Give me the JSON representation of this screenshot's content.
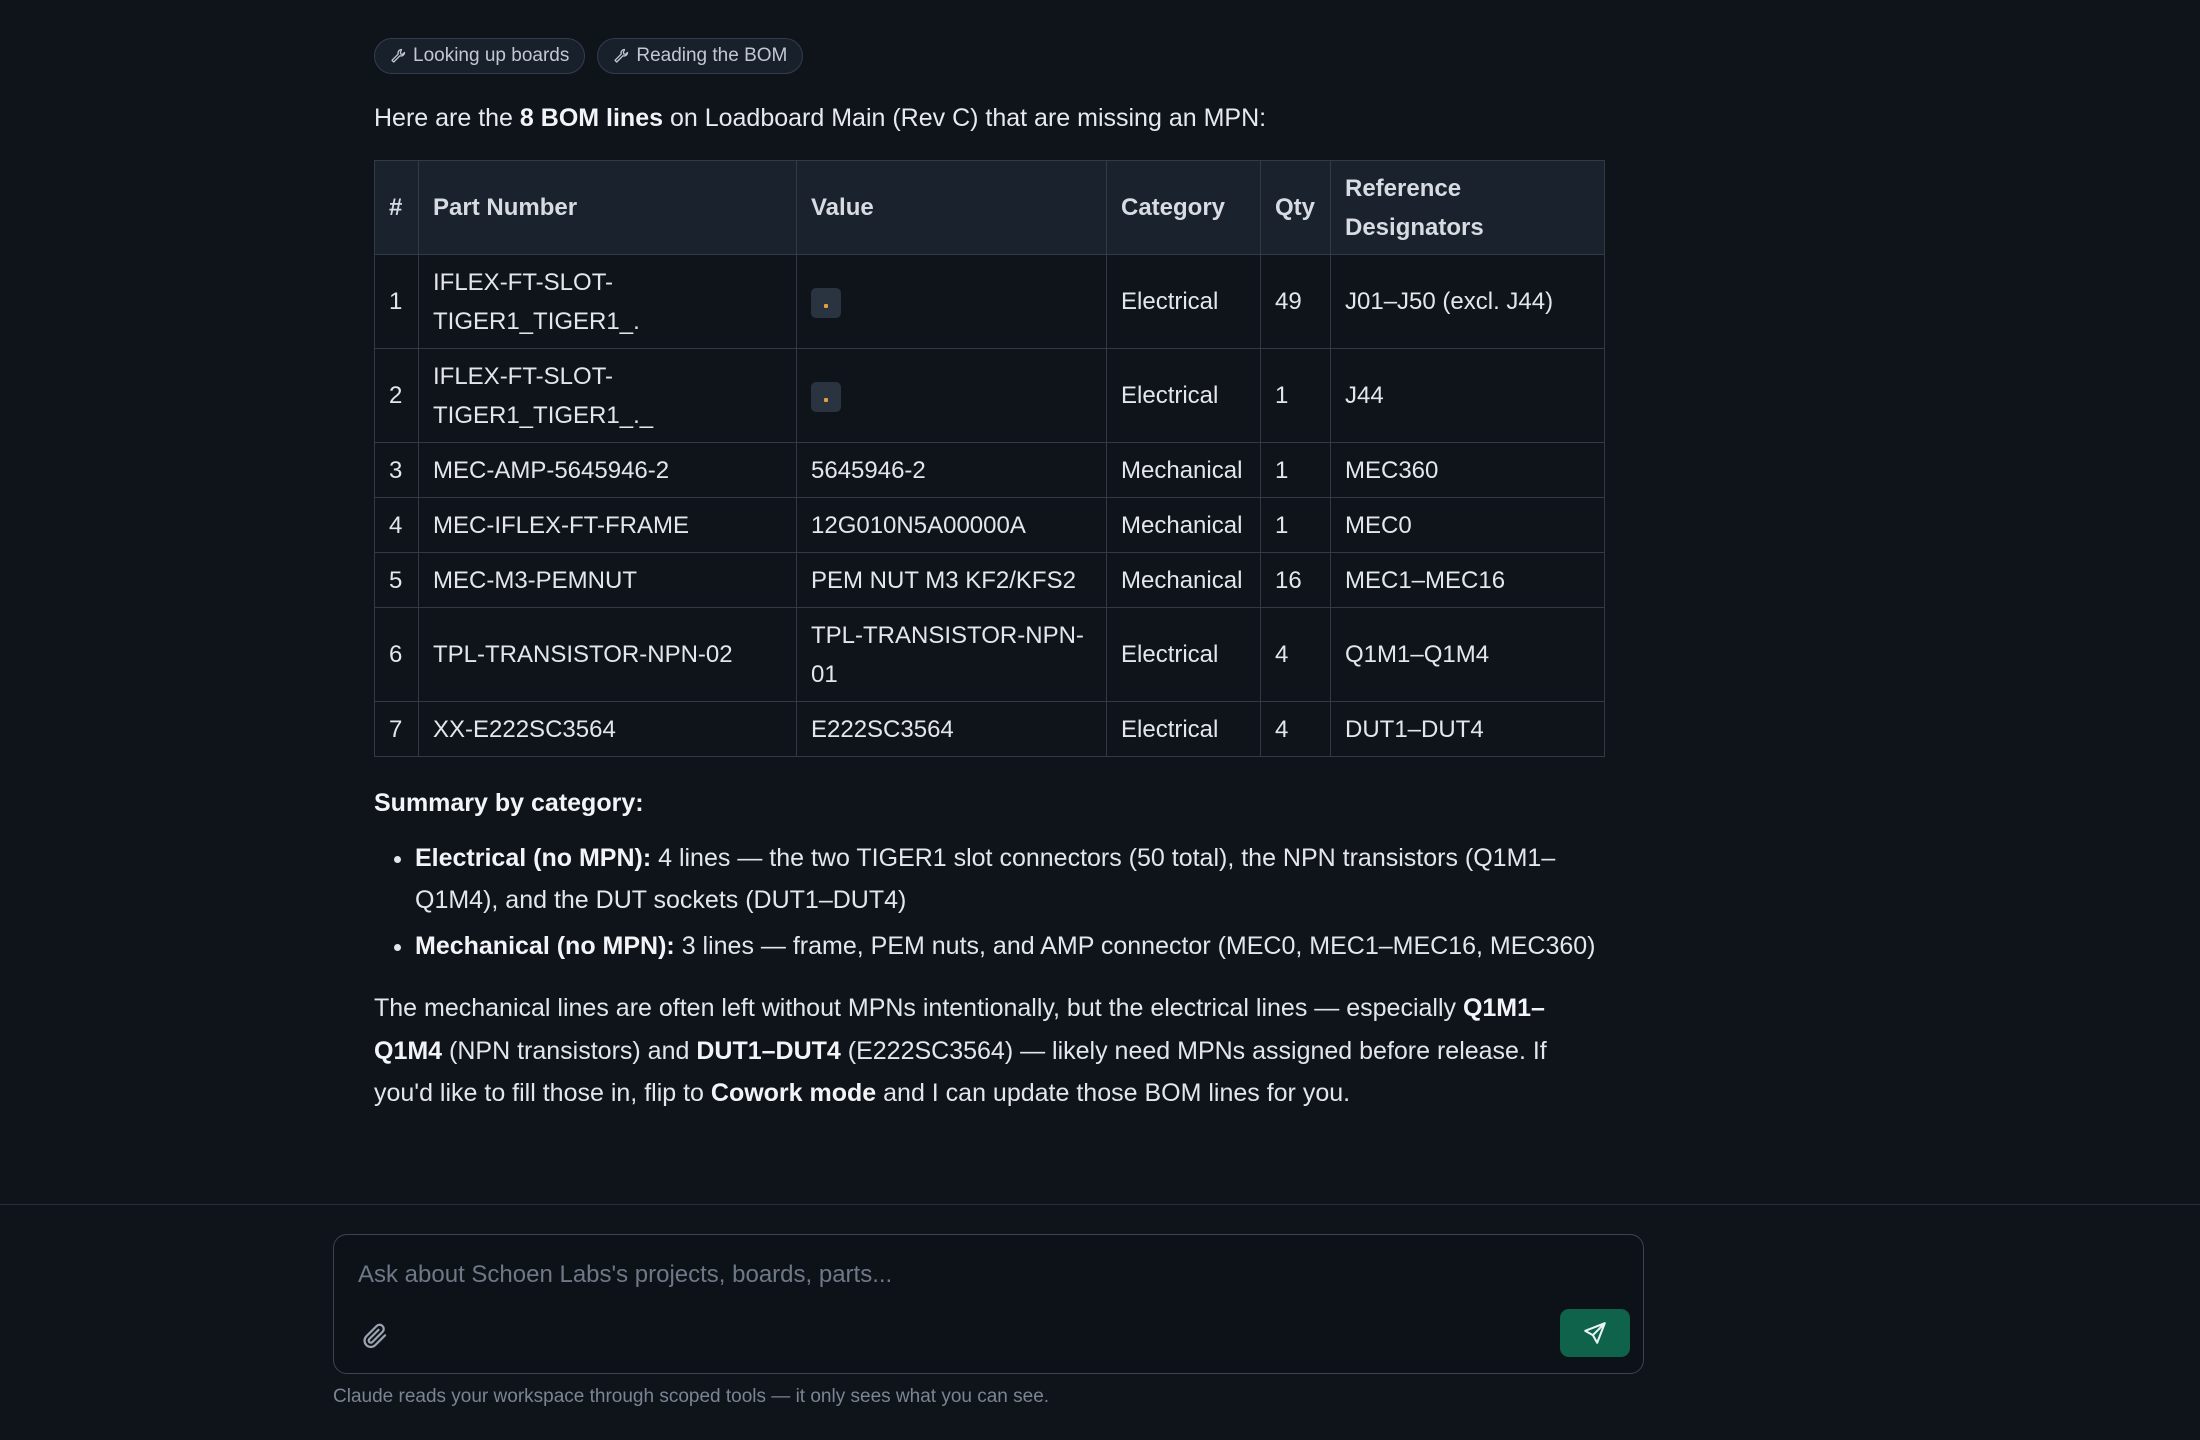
{
  "tool_pills": [
    "Looking up boards",
    "Reading the BOM"
  ],
  "intro": {
    "pre": "Here are the ",
    "bold": "8 BOM lines",
    "post": " on Loadboard Main (Rev C) that are missing an MPN:"
  },
  "table": {
    "headers": [
      "#",
      "Part Number",
      "Value",
      "Category",
      "Qty",
      "Reference Designators"
    ],
    "rows": [
      {
        "n": "1",
        "part": "IFLEX-FT-SLOT-TIGER1_TIGER1_.",
        "value": "",
        "value_chip": true,
        "category": "Electrical",
        "qty": "49",
        "refs": "J01–J50 (excl. J44)"
      },
      {
        "n": "2",
        "part": "IFLEX-FT-SLOT-TIGER1_TIGER1_._",
        "value": "",
        "value_chip": true,
        "category": "Electrical",
        "qty": "1",
        "refs": "J44"
      },
      {
        "n": "3",
        "part": "MEC-AMP-5645946-2",
        "value": "5645946-2",
        "value_chip": false,
        "category": "Mechanical",
        "qty": "1",
        "refs": "MEC360"
      },
      {
        "n": "4",
        "part": "MEC-IFLEX-FT-FRAME",
        "value": "12G010N5A00000A",
        "value_chip": false,
        "category": "Mechanical",
        "qty": "1",
        "refs": "MEC0"
      },
      {
        "n": "5",
        "part": "MEC-M3-PEMNUT",
        "value": "PEM NUT M3 KF2/KFS2",
        "value_chip": false,
        "category": "Mechanical",
        "qty": "16",
        "refs": "MEC1–MEC16"
      },
      {
        "n": "6",
        "part": "TPL-TRANSISTOR-NPN-02",
        "value": "TPL-TRANSISTOR-NPN-01",
        "value_chip": false,
        "category": "Electrical",
        "qty": "4",
        "refs": "Q1M1–Q1M4"
      },
      {
        "n": "7",
        "part": "XX-E222SC3564",
        "value": "E222SC3564",
        "value_chip": false,
        "category": "Electrical",
        "qty": "4",
        "refs": "DUT1–DUT4"
      }
    ]
  },
  "summary": {
    "heading": "Summary by category:",
    "items": [
      {
        "bold": "Electrical (no MPN):",
        "text": " 4 lines — the two TIGER1 slot connectors (50 total), the NPN transistors (Q1M1–Q1M4), and the DUT sockets (DUT1–DUT4)"
      },
      {
        "bold": "Mechanical (no MPN):",
        "text": " 3 lines — frame, PEM nuts, and AMP connector (MEC0, MEC1–MEC16, MEC360)"
      }
    ]
  },
  "closing": {
    "t1": "The mechanical lines are often left without MPNs intentionally, but the electrical lines — especially ",
    "b1": "Q1M1–Q1M4",
    "t2": " (NPN transistors) and ",
    "b2": "DUT1–DUT4",
    "t3": " (E222SC3564) — likely need MPNs assigned before release. If you'd like to fill those in, flip to ",
    "b3": "Cowork mode",
    "t4": " and I can update those BOM lines for you."
  },
  "composer": {
    "placeholder": "Ask about Schoen Labs's projects, boards, parts...",
    "value": "",
    "attach_icon": "paperclip-icon",
    "send_icon": "send-icon",
    "send_color": "#10634b"
  },
  "disclaimer": "Claude reads your workspace through scoped tools — it only sees what you can see."
}
